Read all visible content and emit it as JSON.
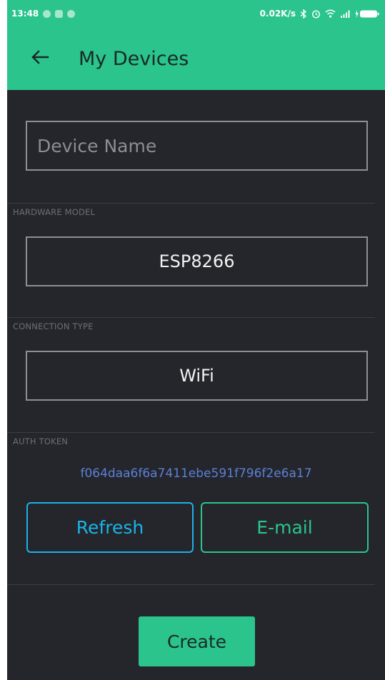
{
  "status_bar": {
    "time": "13:48",
    "network_speed": "0.02K/s",
    "icons": [
      "notification-icon",
      "notification-icon",
      "notification-icon",
      "bluetooth-icon",
      "alarm-icon",
      "wifi-icon",
      "signal-icon",
      "battery-charging-icon"
    ]
  },
  "app_bar": {
    "title": "My Devices",
    "back_icon": "back-arrow-icon"
  },
  "device_name": {
    "placeholder": "Device Name",
    "value": ""
  },
  "hardware_model": {
    "label": "HARDWARE MODEL",
    "value": "ESP8266"
  },
  "connection_type": {
    "label": "CONNECTION TYPE",
    "value": "WiFi"
  },
  "auth_token": {
    "label": "AUTH TOKEN",
    "value": "f064daa6f6a7411ebe591f796f2e6a17"
  },
  "actions": {
    "refresh_label": "Refresh",
    "email_label": "E-mail",
    "create_label": "Create"
  },
  "colors": {
    "accent_green": "#2bc48d",
    "accent_blue": "#1ab3e8",
    "token_blue": "#5c7fd6",
    "background": "#24262b"
  }
}
